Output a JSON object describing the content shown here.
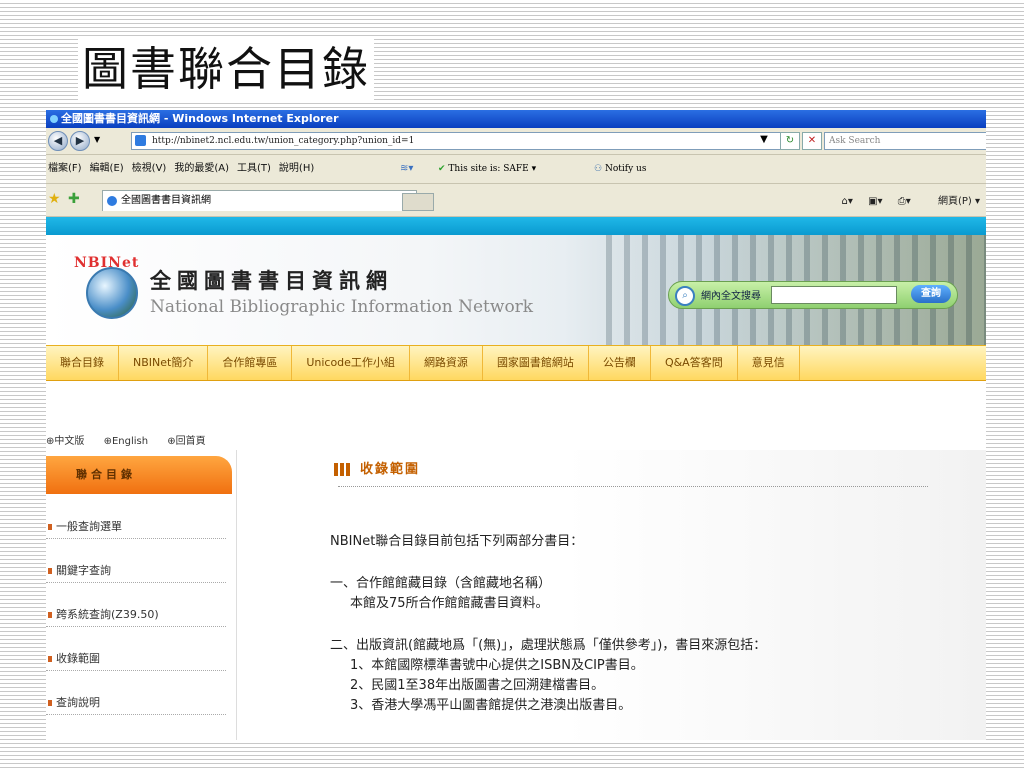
{
  "slide": {
    "title": "圖書聯合目錄"
  },
  "browser": {
    "window_title": "全國圖書書目資訊網 - Windows Internet Explorer",
    "url": "http://nbinet2.ncl.edu.tw/union_category.php?union_id=1",
    "search_placeholder": "Ask Search",
    "menu": [
      "檔案(F)",
      "編輯(E)",
      "檢視(V)",
      "我的最愛(A)",
      "工具(T)",
      "說明(H)"
    ],
    "safe_text": "This site is: SAFE",
    "notify_text": "Notify us",
    "tab_label": "全國圖書書目資訊網",
    "page_cmd": "網頁(P)"
  },
  "site": {
    "logo_text": "NBINet",
    "name_cn": "全國圖書書目資訊網",
    "name_en": "National Bibliographic Information Network",
    "search_label": "網內全文搜尋",
    "search_button": "查詢",
    "nav": [
      "聯合目錄",
      "NBINet簡介",
      "合作館專區",
      "Unicode工作小組",
      "網路資源",
      "國家圖書館網站",
      "公告欄",
      "Q&A答客問",
      "意見信"
    ],
    "lang_links": [
      "中文版",
      "English",
      "回首頁"
    ]
  },
  "sidebar": {
    "heading": "聯合目錄",
    "items": [
      "一般查詢選單",
      "關鍵字查詢",
      "跨系統查詢(Z39.50)",
      "收錄範圍",
      "查詢說明"
    ]
  },
  "content": {
    "heading": "收錄範圍",
    "intro": "NBINet聯合目錄目前包括下列兩部分書目：",
    "section1_title": "一、合作館館藏目錄（含館藏地名稱）",
    "section1_detail": "本館及75所合作館館藏書目資料。",
    "section2_title": "二、出版資訊(館藏地爲「(無)」，處理狀態爲「僅供參考」)，書目來源包括：",
    "section2_items": [
      "1、本館國際標準書號中心提供之ISBN及CIP書目。",
      "2、民國1至38年出版圖書之回溯建檔書目。",
      "3、香港大學馮平山圖書館提供之港澳出版書目。"
    ]
  }
}
